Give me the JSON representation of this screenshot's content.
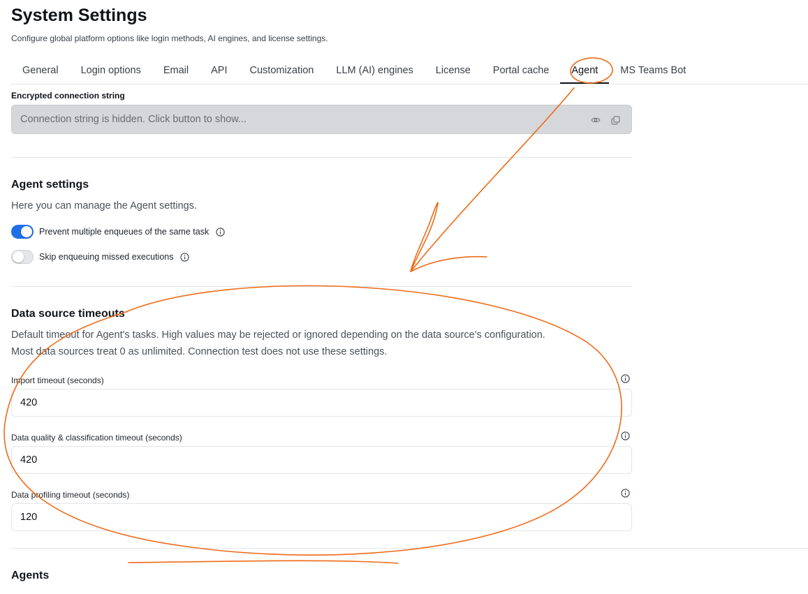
{
  "header": {
    "title": "System Settings",
    "subtitle": "Configure global platform options like login methods, AI engines, and license settings."
  },
  "tabs": [
    {
      "label": "General"
    },
    {
      "label": "Login options"
    },
    {
      "label": "Email"
    },
    {
      "label": "API"
    },
    {
      "label": "Customization"
    },
    {
      "label": "LLM (AI) engines"
    },
    {
      "label": "License"
    },
    {
      "label": "Portal cache"
    },
    {
      "label": "Agent",
      "active": true
    },
    {
      "label": "MS Teams Bot"
    }
  ],
  "connection": {
    "label": "Encrypted connection string",
    "placeholder": "Connection string is hidden. Click button to show...",
    "show_icon": "eye-icon",
    "copy_icon": "copy-icon"
  },
  "agent_settings": {
    "title": "Agent settings",
    "description": "Here you can manage the Agent settings.",
    "toggles": [
      {
        "label": "Prevent multiple enqueues of the same task",
        "on": true
      },
      {
        "label": "Skip enqueuing missed executions",
        "on": false
      }
    ]
  },
  "timeouts": {
    "title": "Data source timeouts",
    "description_line1": "Default timeout for Agent's tasks. High values may be rejected or ignored depending on the data source's configuration.",
    "description_line2": "Most data sources treat 0 as unlimited. Connection test does not use these settings.",
    "fields": [
      {
        "label": "Import timeout (seconds)",
        "value": "420"
      },
      {
        "label": "Data quality & classification timeout (seconds)",
        "value": "420"
      },
      {
        "label": "Data profiling timeout (seconds)",
        "value": "120"
      }
    ]
  },
  "agents": {
    "title": "Agents"
  },
  "colors": {
    "accent": "#1f6fe8",
    "annotation": "#ee6a17",
    "disabled_field": "#d6d7da"
  }
}
